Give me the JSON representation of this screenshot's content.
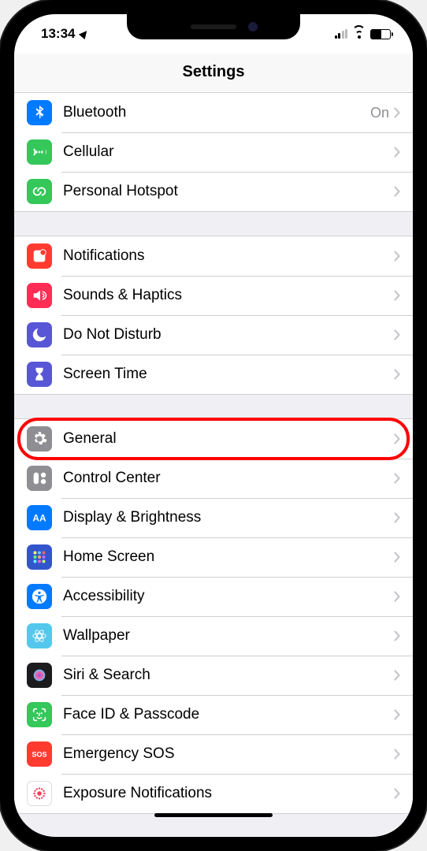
{
  "status": {
    "time": "13:34"
  },
  "header": {
    "title": "Settings"
  },
  "groups": [
    {
      "rows": [
        {
          "id": "bluetooth",
          "label": "Bluetooth",
          "value": "On",
          "iconBg": "#007aff",
          "iconKey": "bluetooth"
        },
        {
          "id": "cellular",
          "label": "Cellular",
          "value": "",
          "iconBg": "#34c759",
          "iconKey": "cellular"
        },
        {
          "id": "hotspot",
          "label": "Personal Hotspot",
          "value": "",
          "iconBg": "#34c759",
          "iconKey": "hotspot"
        }
      ]
    },
    {
      "rows": [
        {
          "id": "notifications",
          "label": "Notifications",
          "value": "",
          "iconBg": "#ff3b30",
          "iconKey": "notifications"
        },
        {
          "id": "sounds",
          "label": "Sounds & Haptics",
          "value": "",
          "iconBg": "#ff2d55",
          "iconKey": "sounds"
        },
        {
          "id": "dnd",
          "label": "Do Not Disturb",
          "value": "",
          "iconBg": "#5856d6",
          "iconKey": "dnd"
        },
        {
          "id": "screentime",
          "label": "Screen Time",
          "value": "",
          "iconBg": "#5856d6",
          "iconKey": "screentime"
        }
      ]
    },
    {
      "rows": [
        {
          "id": "general",
          "label": "General",
          "value": "",
          "iconBg": "#8e8e93",
          "iconKey": "general",
          "highlighted": true
        },
        {
          "id": "controlcenter",
          "label": "Control Center",
          "value": "",
          "iconBg": "#8e8e93",
          "iconKey": "controlcenter"
        },
        {
          "id": "display",
          "label": "Display & Brightness",
          "value": "",
          "iconBg": "#007aff",
          "iconKey": "display"
        },
        {
          "id": "homescreen",
          "label": "Home Screen",
          "value": "",
          "iconBg": "#3355cc",
          "iconKey": "homescreen"
        },
        {
          "id": "accessibility",
          "label": "Accessibility",
          "value": "",
          "iconBg": "#007aff",
          "iconKey": "accessibility"
        },
        {
          "id": "wallpaper",
          "label": "Wallpaper",
          "value": "",
          "iconBg": "#54c7ec",
          "iconKey": "wallpaper"
        },
        {
          "id": "siri",
          "label": "Siri & Search",
          "value": "",
          "iconBg": "#1c1c1e",
          "iconKey": "siri"
        },
        {
          "id": "faceid",
          "label": "Face ID & Passcode",
          "value": "",
          "iconBg": "#34c759",
          "iconKey": "faceid"
        },
        {
          "id": "sos",
          "label": "Emergency SOS",
          "value": "",
          "iconBg": "#ff3b30",
          "iconKey": "sos"
        },
        {
          "id": "exposure",
          "label": "Exposure Notifications",
          "value": "",
          "iconBg": "#ffffff",
          "iconKey": "exposure"
        }
      ]
    }
  ]
}
